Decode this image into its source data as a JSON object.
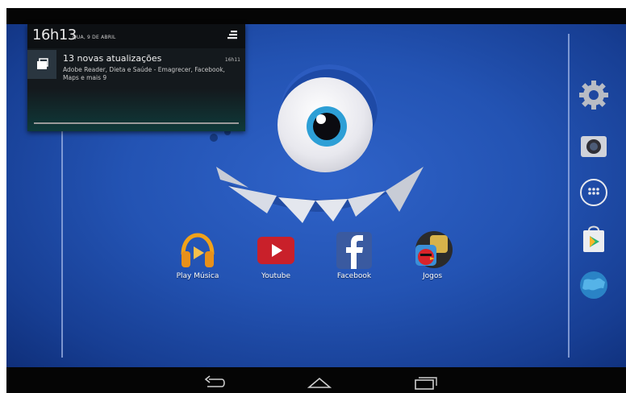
{
  "status": {
    "time": "16h13",
    "date": "QUA, 9 DE ABRIL"
  },
  "notification": {
    "icon": "updates-icon",
    "title": "13 novas atualizações",
    "time": "16h11",
    "body": "Adobe Reader, Dieta e Saúde - Emagrecer, Facebook, Maps e mais 9"
  },
  "apps": [
    {
      "label": "Play Música",
      "icon": "headphones-icon"
    },
    {
      "label": "Youtube",
      "icon": "youtube-play-icon"
    },
    {
      "label": "Facebook",
      "icon": "facebook-f-icon"
    },
    {
      "label": "Jogos",
      "icon": "angry-bird-icon"
    }
  ],
  "dock": [
    {
      "icon": "gear-icon"
    },
    {
      "icon": "camera-icon"
    },
    {
      "icon": "app-drawer-icon"
    },
    {
      "icon": "play-store-icon"
    },
    {
      "icon": "globe-icon"
    }
  ],
  "nav": [
    {
      "icon": "back-icon"
    },
    {
      "icon": "home-icon"
    },
    {
      "icon": "recent-apps-icon"
    }
  ],
  "colors": {
    "wallpaper": "#2353b3",
    "iris": "#2d9fd6",
    "navbar": "#050505"
  }
}
